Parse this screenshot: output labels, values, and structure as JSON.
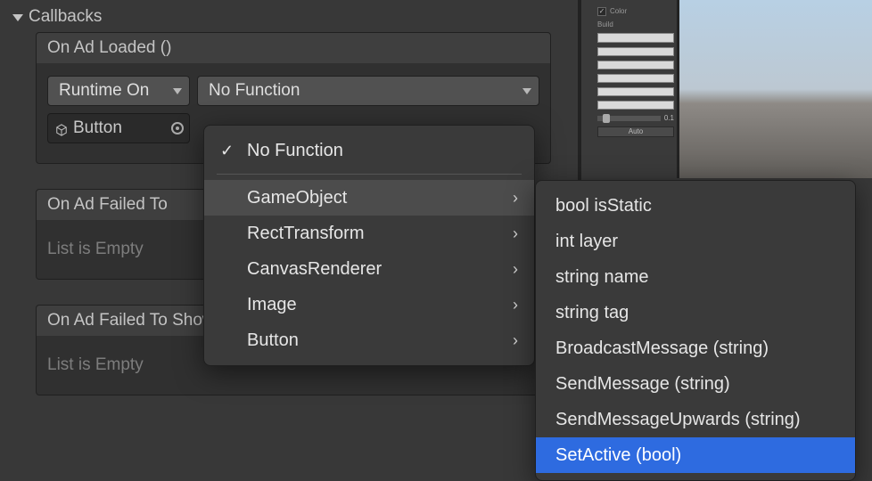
{
  "section": {
    "title": "Callbacks"
  },
  "events": {
    "onAdLoaded": {
      "title": "On Ad Loaded ()",
      "runtime": "Runtime On",
      "function": "No Function",
      "target": "Button"
    },
    "onAdFailedToLoad": {
      "title": "On Ad Failed To",
      "empty": "List is Empty"
    },
    "onAdFailedToShow": {
      "title": "On Ad Failed To Show ()",
      "empty": "List is Empty"
    }
  },
  "menu1": {
    "noFunction": "No Function",
    "items": [
      {
        "label": "GameObject",
        "hover": true
      },
      {
        "label": "RectTransform"
      },
      {
        "label": "CanvasRenderer"
      },
      {
        "label": "Image"
      },
      {
        "label": "Button"
      }
    ]
  },
  "menu2": {
    "items": [
      {
        "label": "bool isStatic"
      },
      {
        "label": "int layer"
      },
      {
        "label": "string name"
      },
      {
        "label": "string tag"
      },
      {
        "label": "BroadcastMessage (string)"
      },
      {
        "label": "SendMessage (string)"
      },
      {
        "label": "SendMessageUpwards (string)"
      },
      {
        "label": "SetActive (bool)",
        "selected": true
      }
    ]
  },
  "panelstrip": {
    "color": "Color",
    "build": "Build",
    "val1": "0.1",
    "val2": "Auto"
  }
}
